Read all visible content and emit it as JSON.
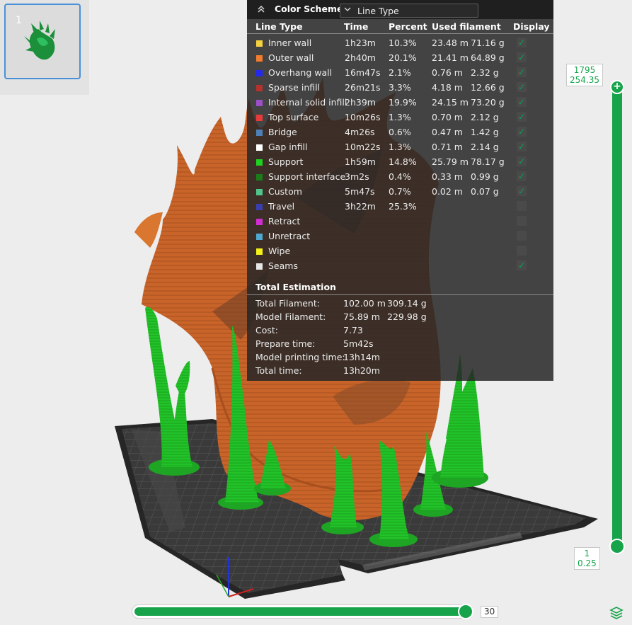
{
  "plate": {
    "number": "1"
  },
  "color_scheme": {
    "label": "Color Scheme",
    "selected": "Line Type"
  },
  "columns": [
    "Line Type",
    "Time",
    "Percent",
    "Used filament",
    "Display"
  ],
  "rows": [
    {
      "name": "Inner wall",
      "time": "1h23m",
      "percent": "10.3%",
      "length": "23.48 m",
      "weight": "71.16 g",
      "color": "#f5d33f",
      "checked": true
    },
    {
      "name": "Outer wall",
      "time": "2h40m",
      "percent": "20.1%",
      "length": "21.41 m",
      "weight": "64.89 g",
      "color": "#f07d2d",
      "checked": true
    },
    {
      "name": "Overhang wall",
      "time": "16m47s",
      "percent": "2.1%",
      "length": "0.76 m",
      "weight": "2.32 g",
      "color": "#2329f0",
      "checked": true
    },
    {
      "name": "Sparse infill",
      "time": "26m21s",
      "percent": "3.3%",
      "length": "4.18 m",
      "weight": "12.66 g",
      "color": "#b4312d",
      "checked": true
    },
    {
      "name": "Internal solid infill",
      "time": "2h39m",
      "percent": "19.9%",
      "length": "24.15 m",
      "weight": "73.20 g",
      "color": "#9c4fc8",
      "checked": true
    },
    {
      "name": "Top surface",
      "time": "10m26s",
      "percent": "1.3%",
      "length": "0.70 m",
      "weight": "2.12 g",
      "color": "#e83a3a",
      "checked": true
    },
    {
      "name": "Bridge",
      "time": "4m26s",
      "percent": "0.6%",
      "length": "0.47 m",
      "weight": "1.42 g",
      "color": "#4d7fb8",
      "checked": true
    },
    {
      "name": "Gap infill",
      "time": "10m22s",
      "percent": "1.3%",
      "length": "0.71 m",
      "weight": "2.14 g",
      "color": "#ffffff",
      "checked": true
    },
    {
      "name": "Support",
      "time": "1h59m",
      "percent": "14.8%",
      "length": "25.79 m",
      "weight": "78.17 g",
      "color": "#1fd21f",
      "checked": true
    },
    {
      "name": "Support interface",
      "time": "3m2s",
      "percent": "0.4%",
      "length": "0.33 m",
      "weight": "0.99 g",
      "color": "#1a7d1a",
      "checked": true
    },
    {
      "name": "Custom",
      "time": "5m47s",
      "percent": "0.7%",
      "length": "0.02 m",
      "weight": "0.07 g",
      "color": "#4fc48c",
      "checked": true
    },
    {
      "name": "Travel",
      "time": "3h22m",
      "percent": "25.3%",
      "length": "",
      "weight": "",
      "color": "#3a3fb0",
      "checked": false
    },
    {
      "name": "Retract",
      "time": "",
      "percent": "",
      "length": "",
      "weight": "",
      "color": "#d22dd2",
      "checked": false
    },
    {
      "name": "Unretract",
      "time": "",
      "percent": "",
      "length": "",
      "weight": "",
      "color": "#4fa8d0",
      "checked": false
    },
    {
      "name": "Wipe",
      "time": "",
      "percent": "",
      "length": "",
      "weight": "",
      "color": "#f5f01a",
      "checked": false
    },
    {
      "name": "Seams",
      "time": "",
      "percent": "",
      "length": "",
      "weight": "",
      "color": "#e6e6e6",
      "checked": true
    }
  ],
  "total": {
    "title": "Total Estimation",
    "items": [
      {
        "label": "Total Filament:",
        "v1": "102.00 m",
        "v2": "309.14 g"
      },
      {
        "label": "Model Filament:",
        "v1": "75.89 m",
        "v2": "229.98 g"
      },
      {
        "label": "Cost:",
        "v1": "7.73",
        "v2": ""
      },
      {
        "label": "Prepare time:",
        "v1": "5m42s",
        "v2": ""
      },
      {
        "label": "Model printing time:",
        "v1": "13h14m",
        "v2": ""
      },
      {
        "label": "Total time:",
        "v1": "13h20m",
        "v2": ""
      }
    ]
  },
  "layer_slider": {
    "top_layer": "1795",
    "top_height": "254.35",
    "bottom_layer": "1",
    "bottom_height": "0.25"
  },
  "move_slider": {
    "value": "30"
  },
  "checkmark": "✓",
  "accent_color": "#16a34a"
}
